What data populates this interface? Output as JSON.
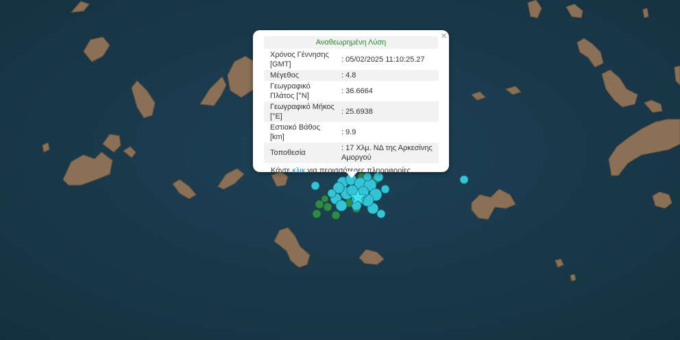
{
  "popup": {
    "title": "Αναθεωρημένη Λύση",
    "close_symbol": "×",
    "rows": [
      {
        "label": "Χρόνος Γέννησης [GMT]",
        "value": ": 05/02/2025 11:10:25.27"
      },
      {
        "label": "Μέγεθος",
        "value": ": 4.8"
      },
      {
        "label": "Γεωγραφικό Πλάτος [°N]",
        "value": ": 36.6664"
      },
      {
        "label": "Γεωγραφικό Μήκος [°E]",
        "value": ": 25.6938"
      },
      {
        "label": "Εστιακό Βάθος [km]",
        "value": ": 9.9"
      },
      {
        "label": "Τοποθεσία",
        "value": ": 17 Χλμ. ΝΔ της Αρκεσίνης Αμοργού"
      }
    ],
    "more_prefix": "Κάντε ",
    "more_link": "κλικ",
    "more_suffix": " για περισσότερες πληροφορίες"
  },
  "colors": {
    "sea": "#1b3a4b",
    "land": "#8a7055",
    "quake_recent": "#35c4d6",
    "quake_older": "#2f8a47",
    "epicenter_star": "#42e2f0",
    "popup_title": "#2a8a2a",
    "link": "#1f7fc4"
  },
  "map_icons": {
    "epicenter": "star-icon",
    "events": "circle-marker"
  }
}
